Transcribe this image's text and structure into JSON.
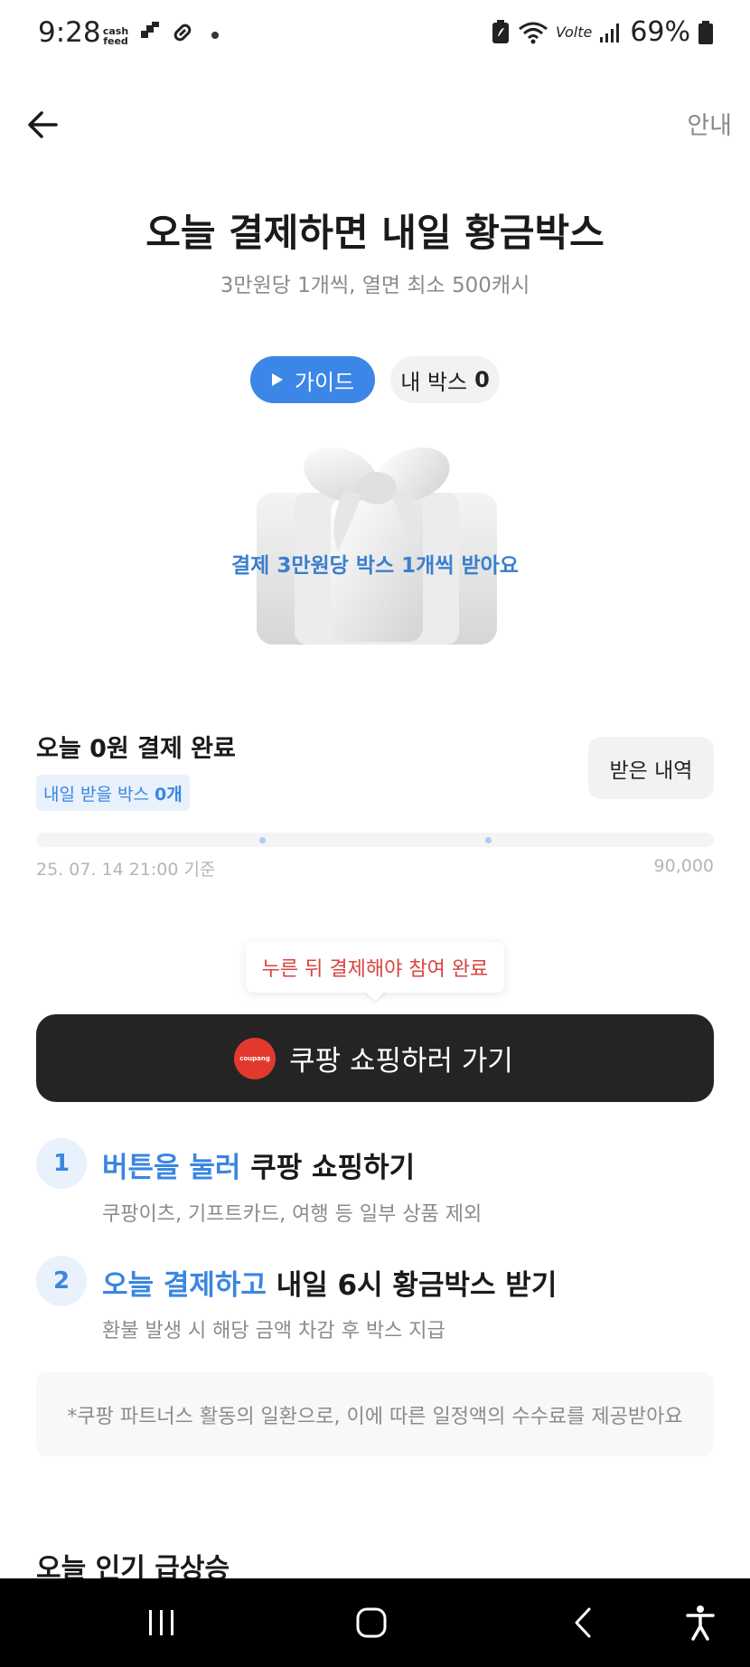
{
  "status_bar": {
    "time": "9:28",
    "cashfeed": "cash feed",
    "volte": "Vo",
    "volte_suffix": "lte",
    "battery": "69%"
  },
  "header": {
    "guide_link": "안내"
  },
  "hero": {
    "title": "오늘 결제하면 내일 황금박스",
    "subtitle": "3만원당 1개씩, 열면 최소 500캐시",
    "guide_pill": "가이드",
    "mybox_label": "내 박스",
    "mybox_count": "0",
    "box_caption": "결제 3만원당 박스 1개씩 받아요"
  },
  "progress": {
    "title": "오늘 0원 결제 완료",
    "badge_prefix": "내일 받을 박스 ",
    "badge_count": "0개",
    "history_button": "받은 내역",
    "date": "25. 07. 14 21:00 기준",
    "max_label": "90,000",
    "current_amount": 0,
    "max_amount": 90000,
    "milestones": [
      30000,
      60000
    ]
  },
  "cta": {
    "tooltip": "누른 뒤 결제해야 참여 완료",
    "button": "쿠팡 쇼핑하러 가기",
    "logo_text": "coupang"
  },
  "steps": [
    {
      "number": "1",
      "highlight": "버튼을 눌러",
      "title_rest": " 쿠팡 쇼핑하기",
      "desc": "쿠팡이츠, 기프트카드, 여행 등 일부 상품 제외"
    },
    {
      "number": "2",
      "highlight": "오늘 결제하고",
      "title_rest": " 내일 6시 황금박스 받기",
      "desc": "환불 발생 시 해당 금액 차감 후 박스 지급"
    }
  ],
  "notice": "*쿠팡 파트너스 활동의 일환으로, 이에 따른 일정액의 수수료를 제공받아요",
  "popular": {
    "title": "오늘 인기 급상승"
  },
  "colors": {
    "accent": "#3b86e6",
    "cta_background": "#242424",
    "tooltip_text": "#d9433f",
    "coupang_red": "#e2392f"
  },
  "icons": {
    "back": "arrow-left-icon",
    "guide": "play-icon",
    "nav_recent": "recent-apps-icon",
    "nav_home": "home-icon",
    "nav_back": "back-chevron-icon",
    "nav_accessibility": "accessibility-icon"
  }
}
